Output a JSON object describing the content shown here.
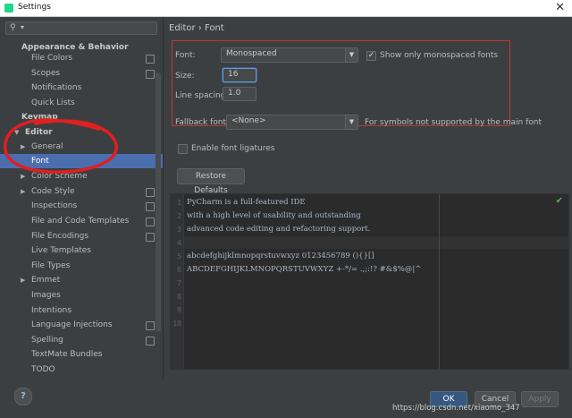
{
  "window": {
    "title": "Settings"
  },
  "search": {
    "icon": "search-icon",
    "caret": "▾"
  },
  "sidebar": {
    "items": [
      {
        "label": "Appearance & Behavior"
      },
      {
        "label": "File Colors"
      },
      {
        "label": "Scopes"
      },
      {
        "label": "Notifications"
      },
      {
        "label": "Quick Lists"
      },
      {
        "label": "Keymap"
      },
      {
        "label": "Editor"
      },
      {
        "label": "General"
      },
      {
        "label": "Font"
      },
      {
        "label": "Color Scheme"
      },
      {
        "label": "Code Style"
      },
      {
        "label": "Inspections"
      },
      {
        "label": "File and Code Templates"
      },
      {
        "label": "File Encodings"
      },
      {
        "label": "Live Templates"
      },
      {
        "label": "File Types"
      },
      {
        "label": "Emmet"
      },
      {
        "label": "Images"
      },
      {
        "label": "Intentions"
      },
      {
        "label": "Language Injections"
      },
      {
        "label": "Spelling"
      },
      {
        "label": "TextMate Bundles"
      },
      {
        "label": "TODO"
      }
    ]
  },
  "main": {
    "breadcrumb": "Editor  ›  Font",
    "font": {
      "label": "Font:",
      "value": "Monospaced"
    },
    "only_mono": {
      "label": "Show only monospaced fonts",
      "checked": true
    },
    "size": {
      "label": "Size:",
      "value": "16"
    },
    "line_spacing": {
      "label": "Line spacing:",
      "value": "1.0"
    },
    "fallback": {
      "label": "Fallback font:",
      "value": "<None>",
      "hint": "For symbols not supported by the main font"
    },
    "ligatures": {
      "label": "Enable font ligatures",
      "checked": false
    },
    "restore_button": "Restore Defaults"
  },
  "preview": {
    "line_numbers": [
      "1",
      "2",
      "3",
      "4",
      "5",
      "6",
      "7",
      "8",
      "9",
      "10"
    ],
    "lines": [
      "PyCharm is a full-featured IDE",
      "with a high level of usability and outstanding",
      "advanced code editing and refactoring support.",
      "",
      "abcdefghijklmnopqrstuvwxyz 0123456789 (){}[]",
      "ABCDEFGHIJKLMNOPQRSTUVWXYZ +-*/= .,;:!? #&$%@|^"
    ]
  },
  "footer": {
    "help": "?",
    "ok": "OK",
    "cancel": "Cancel",
    "apply": "Apply"
  },
  "watermark": "https://blog.csdn.net/xiaomo_347",
  "colors": {
    "selection": "#4b6eaf",
    "annotation": "#e02020",
    "highlight_box": "#c0392b"
  }
}
